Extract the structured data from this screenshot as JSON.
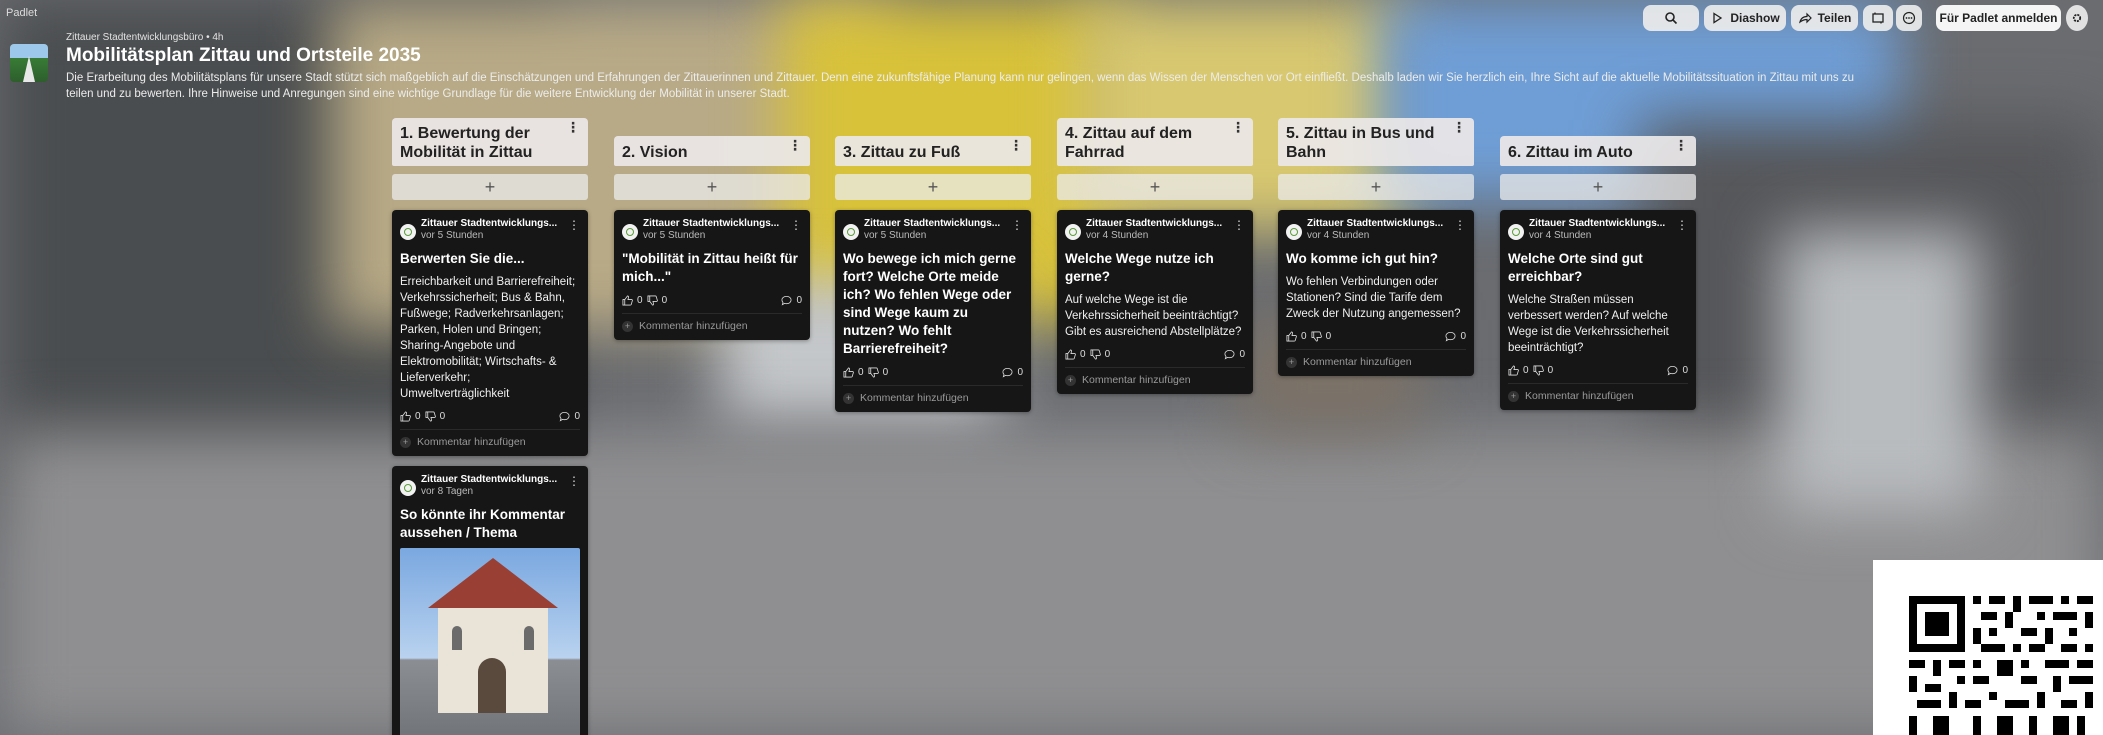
{
  "app": {
    "brand": "Padlet"
  },
  "header": {
    "meta": "Zittauer Stadtentwicklungsbüro • 4h",
    "title": "Mobilitätsplan Zittau und Ortsteile 2035",
    "description": "Die Erarbeitung des Mobilitätsplans für unsere Stadt stützt sich maßgeblich auf die Einschätzungen und Erfahrungen der Zittauerinnen und Zittauer. Denn eine zukunftsfähige Planung kann nur gelingen, wenn das Wissen der Menschen vor Ort einfließt. Deshalb laden wir Sie herzlich ein, Ihre Sicht auf die aktuelle Mobilitätssituation in Zittau mit uns zu teilen und zu bewerten. Ihre Hinweise und Anregungen sind eine wichtige Grundlage für die weitere Entwicklung der Mobilität in unserer Stadt."
  },
  "toolbar": {
    "slideshow_label": "Diashow",
    "share_label": "Teilen",
    "signup_label": "Für Padlet anmelden"
  },
  "columns": [
    {
      "title": "1. Bewertung der Mobilität in Zittau",
      "add_label": "+",
      "posts": [
        {
          "author": "Zittauer Stadtentwicklungs...",
          "time": "vor 5 Stunden",
          "title": "Berwerten Sie die...",
          "body": "Erreichbarkeit und Barrierefreiheit; Verkehrssicherheit; Bus & Bahn, Fußwege; Radverkehrsanlagen; Parken, Holen und Bringen; Sharing-Angebote und Elektromobilität; Wirtschafts- & Lieferverkehr; Umweltverträglichkeit",
          "likes": "0",
          "dislikes": "0",
          "comments": "0",
          "comment_label": "Kommentar hinzufügen"
        },
        {
          "author": "Zittauer Stadtentwicklungs...",
          "time": "vor 8 Tagen",
          "title": "So könnte ihr Kommentar aussehen / Thema"
        }
      ]
    },
    {
      "title": "2. Vision",
      "add_label": "+",
      "posts": [
        {
          "author": "Zittauer Stadtentwicklungs...",
          "time": "vor 5 Stunden",
          "title": "\"Mobilität in Zittau heißt für mich...\"",
          "likes": "0",
          "dislikes": "0",
          "comments": "0",
          "comment_label": "Kommentar hinzufügen"
        }
      ]
    },
    {
      "title": "3. Zittau zu Fuß",
      "add_label": "+",
      "posts": [
        {
          "author": "Zittauer Stadtentwicklungs...",
          "time": "vor 5 Stunden",
          "title": "Wo bewege ich mich gerne fort? Welche Orte meide ich? Wo fehlen Wege oder sind Wege kaum zu nutzen? Wo fehlt Barrierefreiheit?",
          "likes": "0",
          "dislikes": "0",
          "comments": "0",
          "comment_label": "Kommentar hinzufügen"
        }
      ]
    },
    {
      "title": "4. Zittau auf dem Fahrrad",
      "add_label": "+",
      "posts": [
        {
          "author": "Zittauer Stadtentwicklungs...",
          "time": "vor 4 Stunden",
          "title": "Welche Wege nutze ich gerne?",
          "body": "Auf welche Wege ist die Verkehrssicherheit beeinträchtigt? Gibt es ausreichend Abstellplätze?",
          "likes": "0",
          "dislikes": "0",
          "comments": "0",
          "comment_label": "Kommentar hinzufügen"
        }
      ]
    },
    {
      "title": "5. Zittau in Bus und Bahn",
      "add_label": "+",
      "posts": [
        {
          "author": "Zittauer Stadtentwicklungs...",
          "time": "vor 4 Stunden",
          "title": "Wo komme ich gut hin?",
          "body": "Wo fehlen Verbindungen oder Stationen? Sind die Tarife dem Zweck der Nutzung angemessen?",
          "likes": "0",
          "dislikes": "0",
          "comments": "0",
          "comment_label": "Kommentar hinzufügen"
        }
      ]
    },
    {
      "title": "6. Zittau im Auto",
      "add_label": "+",
      "posts": [
        {
          "author": "Zittauer Stadtentwicklungs...",
          "time": "vor 4 Stunden",
          "title": "Welche Orte sind gut erreichbar?",
          "body": "Welche Straßen müssen verbessert werden? Auf welche Wege ist die Verkehrssicherheit beeinträchtigt?",
          "likes": "0",
          "dislikes": "0",
          "comments": "0",
          "comment_label": "Kommentar hinzufügen"
        }
      ]
    }
  ],
  "icons": {
    "search": "search-icon",
    "slideshow": "play-icon",
    "share": "share-arrow-icon",
    "remake": "remake-icon",
    "more": "more-icon",
    "like": "thumbs-up-icon",
    "dislike": "thumbs-down-icon",
    "comment": "comment-bubble-icon"
  },
  "colors": {
    "post_bg": "#161616",
    "column_header_bg": "#ebe8e8"
  }
}
